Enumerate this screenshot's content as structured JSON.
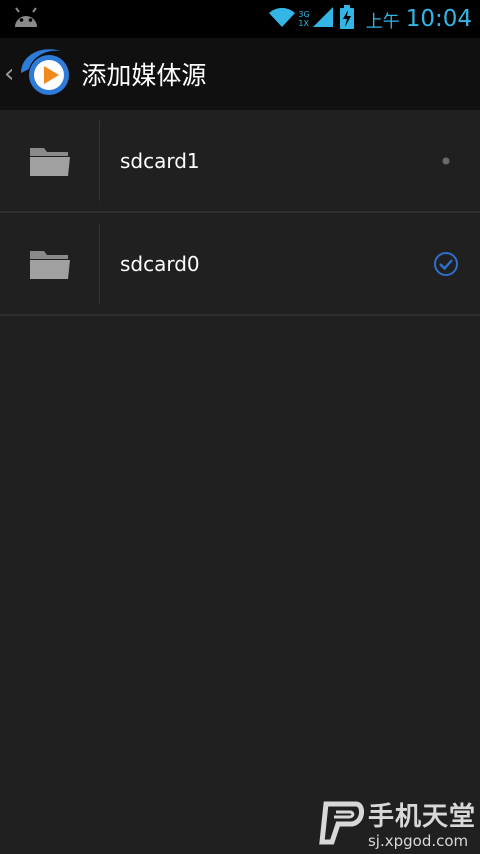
{
  "status_bar": {
    "android_icon": "android-icon",
    "wifi_icon": "wifi-icon",
    "network_top": "3G",
    "network_bottom": "1X",
    "signal_icon": "signal-icon",
    "battery_icon": "battery-charging-icon",
    "ampm": "上午",
    "time": "10:04",
    "accent_color": "#33b5e5"
  },
  "action_bar": {
    "back_icon": "chevron-left-icon",
    "app_icon": "media-player-logo-icon",
    "title": "添加媒体源"
  },
  "list": {
    "items": [
      {
        "label": "sdcard1",
        "folder_icon": "folder-icon",
        "state": "unselected",
        "state_icon": "dot-icon"
      },
      {
        "label": "sdcard0",
        "folder_icon": "folder-icon",
        "state": "selected",
        "state_icon": "check-circle-icon",
        "accent_color": "#2f6fcf"
      }
    ]
  },
  "watermark": {
    "title": "手机天堂",
    "url": "sj.xpgod.com",
    "logo_icon": "xpgod-logo-icon"
  }
}
